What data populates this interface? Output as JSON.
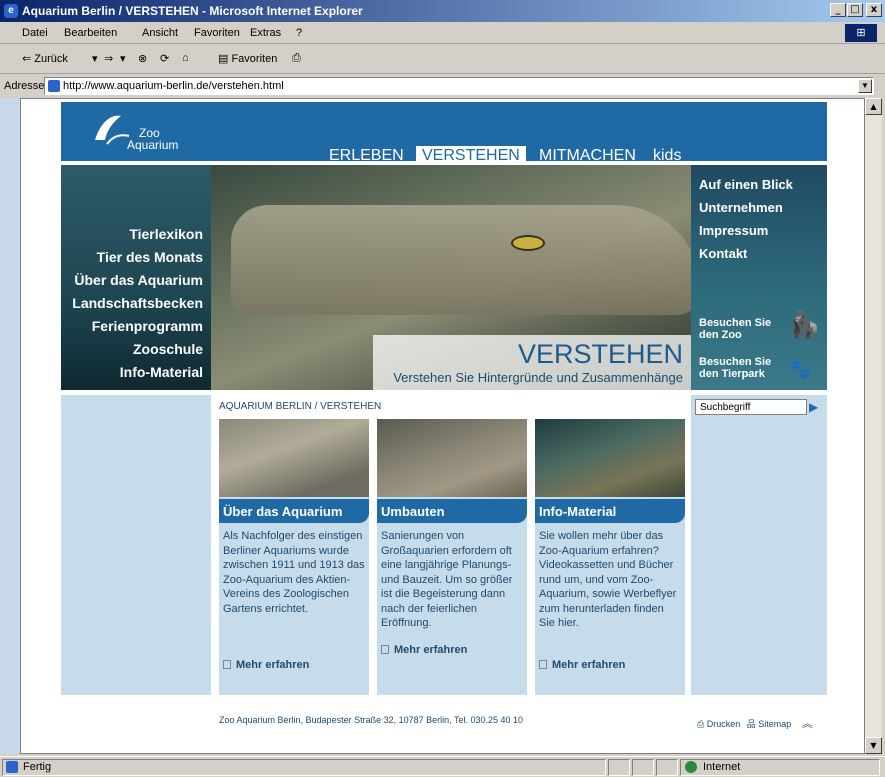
{
  "window": {
    "title": "Aquarium Berlin / VERSTEHEN - Microsoft Internet Explorer",
    "btn_min": "_",
    "btn_max": "□",
    "btn_close": "x"
  },
  "menu": [
    "Datei",
    "Bearbeiten",
    "Ansicht",
    "Favoriten",
    "Extras",
    "?"
  ],
  "toolbar": {
    "back": "⇐ Zurück",
    "forward": "⇒",
    "favorites": "Favoriten"
  },
  "address": {
    "label": "Adresse",
    "url": "http://www.aquarium-berlin.de/verstehen.html"
  },
  "site": {
    "logo_zoo": "Zoo",
    "logo_aquarium": "Aquarium",
    "topnav": [
      "ERLEBEN",
      "VERSTEHEN",
      "MITMACHEN",
      "kids"
    ],
    "leftnav": [
      "Tierlexikon",
      "Tier des Monats",
      "Über das Aquarium",
      "Landschaftsbecken",
      "Ferienprogramm",
      "Zooschule",
      "Info-Material"
    ],
    "rightnav": [
      "Auf einen Blick",
      "Unternehmen",
      "Impressum",
      "Kontakt"
    ],
    "visit_zoo": [
      "Besuchen Sie",
      "den Zoo"
    ],
    "visit_tierpark": [
      "Besuchen Sie",
      "den Tierpark"
    ],
    "hero_title": "VERSTEHEN",
    "hero_subtitle": "Verstehen Sie Hintergründe und Zusammenhänge",
    "breadcrumb": "AQUARIUM BERLIN / VERSTEHEN",
    "search_placeholder": "Suchbegriff",
    "cards": [
      {
        "title": "Über das Aquarium",
        "text": "Als Nachfolger des einstigen Berliner Aquariums wurde zwischen 1911 und 1913 das Zoo-Aquarium des Aktien-Vereins des Zoologischen Gartens errichtet.",
        "more": "Mehr erfahren"
      },
      {
        "title": "Umbauten",
        "text": "Sanierungen von Großaquarien erfordern oft eine langjährige Planungs- und Bauzeit. Um so größer ist die Begeisterung dann nach der feierlichen Eröffnung.",
        "more": "Mehr erfahren"
      },
      {
        "title": "Info-Material",
        "text": "Sie wollen mehr über das Zoo-Aquarium erfahren? Videokassetten und Bücher rund um, und vom Zoo-Aquarium, sowie Werbeflyer zum herunterladen finden Sie hier.",
        "more": "Mehr erfahren"
      }
    ],
    "footer": "Zoo Aquarium Berlin, Budapester Straße 32, 10787 Berlin, Tel. 030.25 40 10",
    "print": "Drucken",
    "sitemap": "Sitemap"
  },
  "status": {
    "text": "Fertig",
    "zone": "Internet"
  }
}
